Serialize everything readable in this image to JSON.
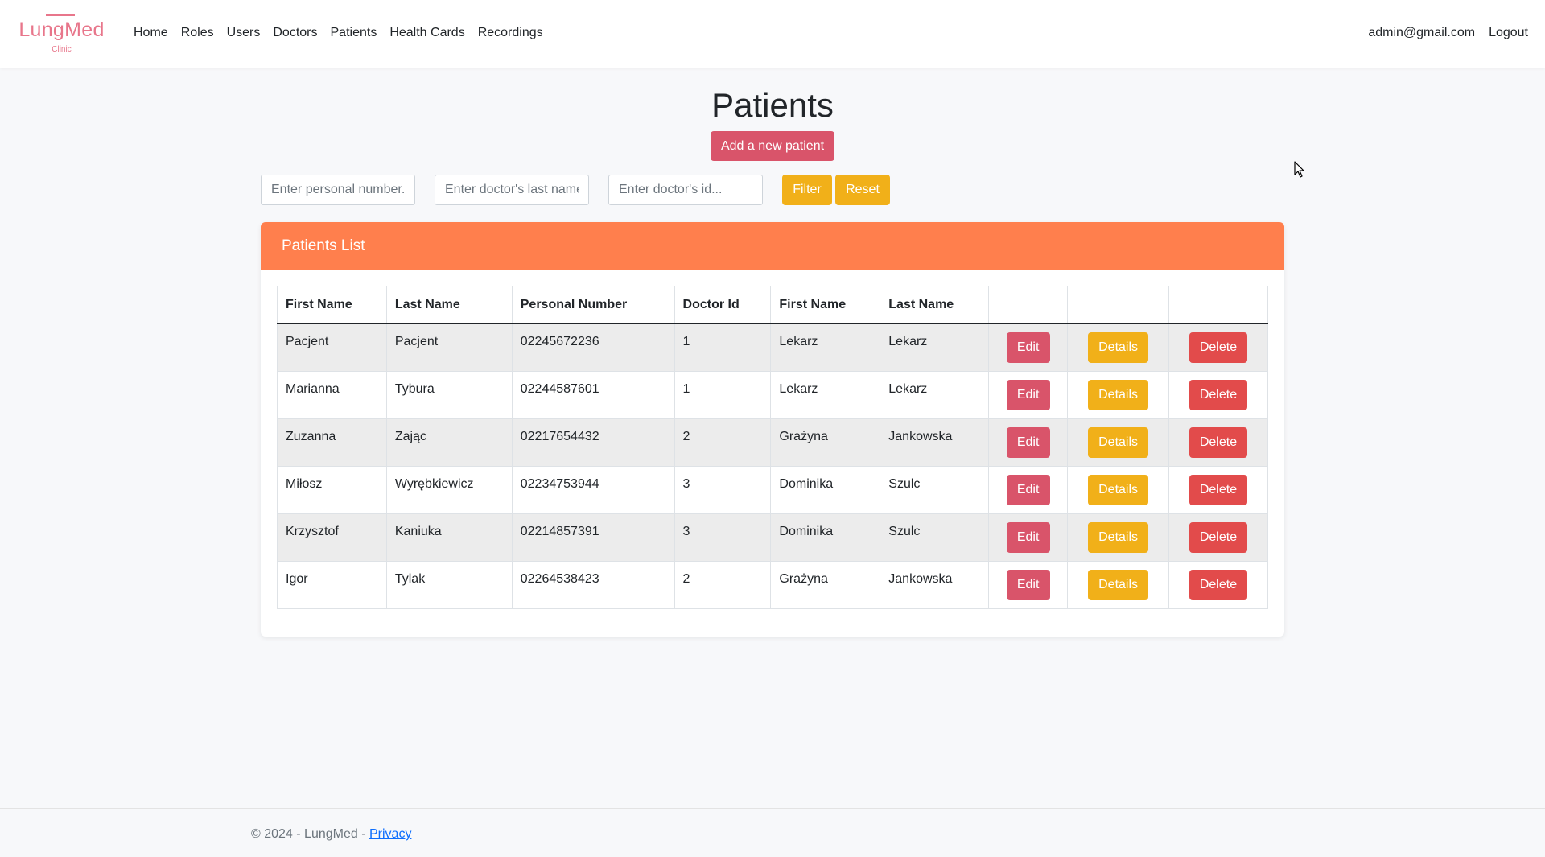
{
  "brand": {
    "name": "LungMed",
    "subtitle": "Clinic",
    "color": "#e8768b"
  },
  "nav": {
    "items": [
      {
        "label": "Home"
      },
      {
        "label": "Roles"
      },
      {
        "label": "Users"
      },
      {
        "label": "Doctors"
      },
      {
        "label": "Patients"
      },
      {
        "label": "Health Cards"
      },
      {
        "label": "Recordings"
      }
    ],
    "user_email": "admin@gmail.com",
    "logout_label": "Logout"
  },
  "page": {
    "title": "Patients",
    "add_button_label": "Add a new patient"
  },
  "filters": {
    "personal_number_placeholder": "Enter personal number...",
    "doctor_last_name_placeholder": "Enter doctor's last name...",
    "doctor_id_placeholder": "Enter doctor's id...",
    "filter_label": "Filter",
    "reset_label": "Reset"
  },
  "card": {
    "title": "Patients List",
    "header_color": "#ff7f4d"
  },
  "table": {
    "headers": [
      "First Name",
      "Last Name",
      "Personal Number",
      "Doctor Id",
      "First Name",
      "Last Name",
      "",
      "",
      ""
    ],
    "rows": [
      {
        "first_name": "Pacjent",
        "last_name": "Pacjent",
        "personal_number": "02245672236",
        "doctor_id": "1",
        "doctor_first_name": "Lekarz",
        "doctor_last_name": "Lekarz"
      },
      {
        "first_name": "Marianna",
        "last_name": "Tybura",
        "personal_number": "02244587601",
        "doctor_id": "1",
        "doctor_first_name": "Lekarz",
        "doctor_last_name": "Lekarz"
      },
      {
        "first_name": "Zuzanna",
        "last_name": "Zając",
        "personal_number": "02217654432",
        "doctor_id": "2",
        "doctor_first_name": "Grażyna",
        "doctor_last_name": "Jankowska"
      },
      {
        "first_name": "Miłosz",
        "last_name": "Wyrębkiewicz",
        "personal_number": "02234753944",
        "doctor_id": "3",
        "doctor_first_name": "Dominika",
        "doctor_last_name": "Szulc"
      },
      {
        "first_name": "Krzysztof",
        "last_name": "Kaniuka",
        "personal_number": "02214857391",
        "doctor_id": "3",
        "doctor_first_name": "Dominika",
        "doctor_last_name": "Szulc"
      },
      {
        "first_name": "Igor",
        "last_name": "Tylak",
        "personal_number": "02264538423",
        "doctor_id": "2",
        "doctor_first_name": "Grażyna",
        "doctor_last_name": "Jankowska"
      }
    ],
    "actions": {
      "edit_label": "Edit",
      "details_label": "Details",
      "delete_label": "Delete"
    }
  },
  "footer": {
    "text": "© 2024 - LungMed - ",
    "privacy_label": "Privacy"
  },
  "colors": {
    "edit": "#d9546a",
    "details": "#f1b019",
    "delete": "#e24b4b"
  },
  "icons": {
    "cursor": "mouse-pointer-icon"
  }
}
